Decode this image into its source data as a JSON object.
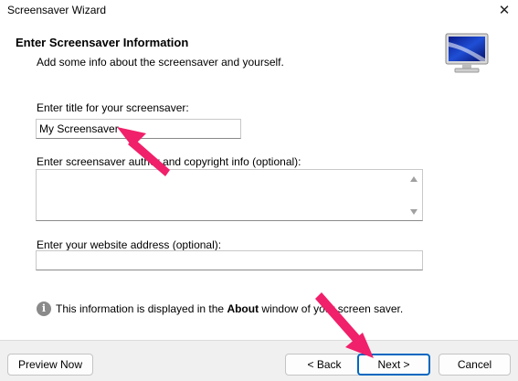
{
  "window": {
    "title": "Screensaver Wizard",
    "close_symbol": "✕"
  },
  "header": {
    "title": "Enter Screensaver Information",
    "subtitle": "Add some info about the screensaver and yourself.",
    "icon": "monitor-icon"
  },
  "fields": {
    "title_label": "Enter title for your screensaver:",
    "title_value": "My Screensaver",
    "author_label": "Enter screensaver author and copyright info (optional):",
    "author_value": "",
    "website_label": "Enter your website address (optional):",
    "website_value": ""
  },
  "info": {
    "icon": "info-icon",
    "text_before": "This information is displayed in the ",
    "text_bold": "About",
    "text_after": " window of your screen saver."
  },
  "buttons": {
    "preview": "Preview Now",
    "back": "< Back",
    "next": "Next >",
    "cancel": "Cancel"
  },
  "colors": {
    "accent": "#0067c0",
    "annotation_arrow": "#f0206a",
    "footer_bg": "#f0f0f0"
  }
}
